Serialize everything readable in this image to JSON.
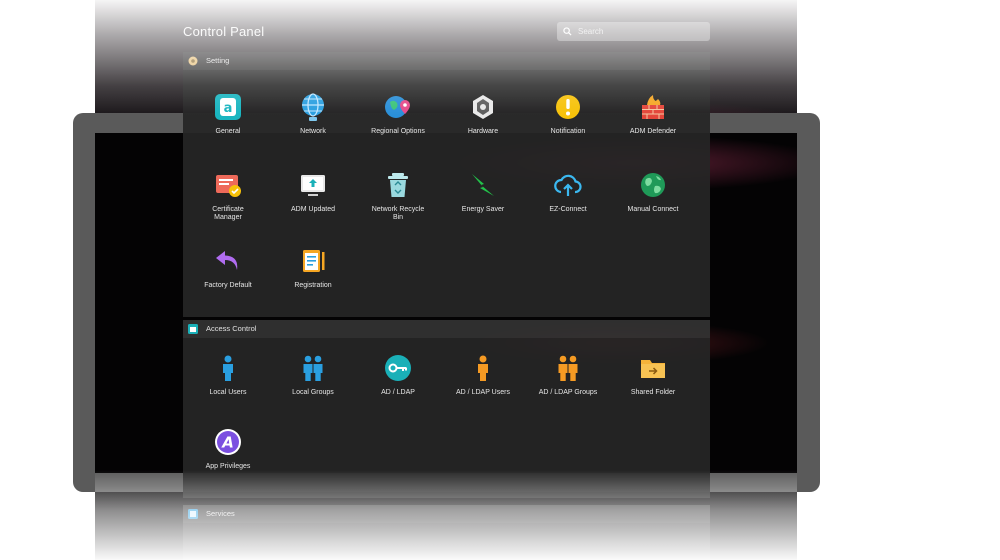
{
  "window": {
    "title": "Control Panel",
    "search_placeholder": "Search"
  },
  "sections": {
    "setting": {
      "title": "Setting",
      "items": [
        {
          "label": "General",
          "icon": "general-icon"
        },
        {
          "label": "Network",
          "icon": "globe-icon"
        },
        {
          "label": "Regional Options",
          "icon": "regional-options-icon"
        },
        {
          "label": "Hardware",
          "icon": "hardware-icon"
        },
        {
          "label": "Notification",
          "icon": "notification-icon"
        },
        {
          "label": "ADM Defender",
          "icon": "firewall-icon"
        },
        {
          "label": "Certificate\nManager",
          "icon": "certificate-icon"
        },
        {
          "label": "ADM Updated",
          "icon": "update-icon"
        },
        {
          "label": "Network Recycle\nBin",
          "icon": "recycle-bin-icon"
        },
        {
          "label": "Energy Saver",
          "icon": "lightning-icon"
        },
        {
          "label": "EZ-Connect",
          "icon": "cloud-upload-icon"
        },
        {
          "label": "Manual Connect",
          "icon": "manual-connect-globe-icon"
        },
        {
          "label": "Factory Default",
          "icon": "undo-arrow-icon"
        },
        {
          "label": "Registration",
          "icon": "clipboard-icon"
        }
      ]
    },
    "access": {
      "title": "Access Control",
      "items": [
        {
          "label": "Local Users",
          "icon": "user-icon"
        },
        {
          "label": "Local Groups",
          "icon": "group-icon"
        },
        {
          "label": "AD / LDAP",
          "icon": "key-icon"
        },
        {
          "label": "AD / LDAP Users",
          "icon": "ldap-user-icon"
        },
        {
          "label": "AD / LDAP Groups",
          "icon": "ldap-group-icon"
        },
        {
          "label": "Shared Folder",
          "icon": "folder-icon"
        },
        {
          "label": "App Privileges",
          "icon": "app-privileges-icon"
        }
      ]
    },
    "services": {
      "title": "Services"
    }
  },
  "colors": {
    "panel_bg": "#262626",
    "accent_teal": "#1ab0b8",
    "accent_orange": "#f59a23",
    "accent_blue": "#2a9fe0",
    "accent_purple": "#8a55e0"
  }
}
